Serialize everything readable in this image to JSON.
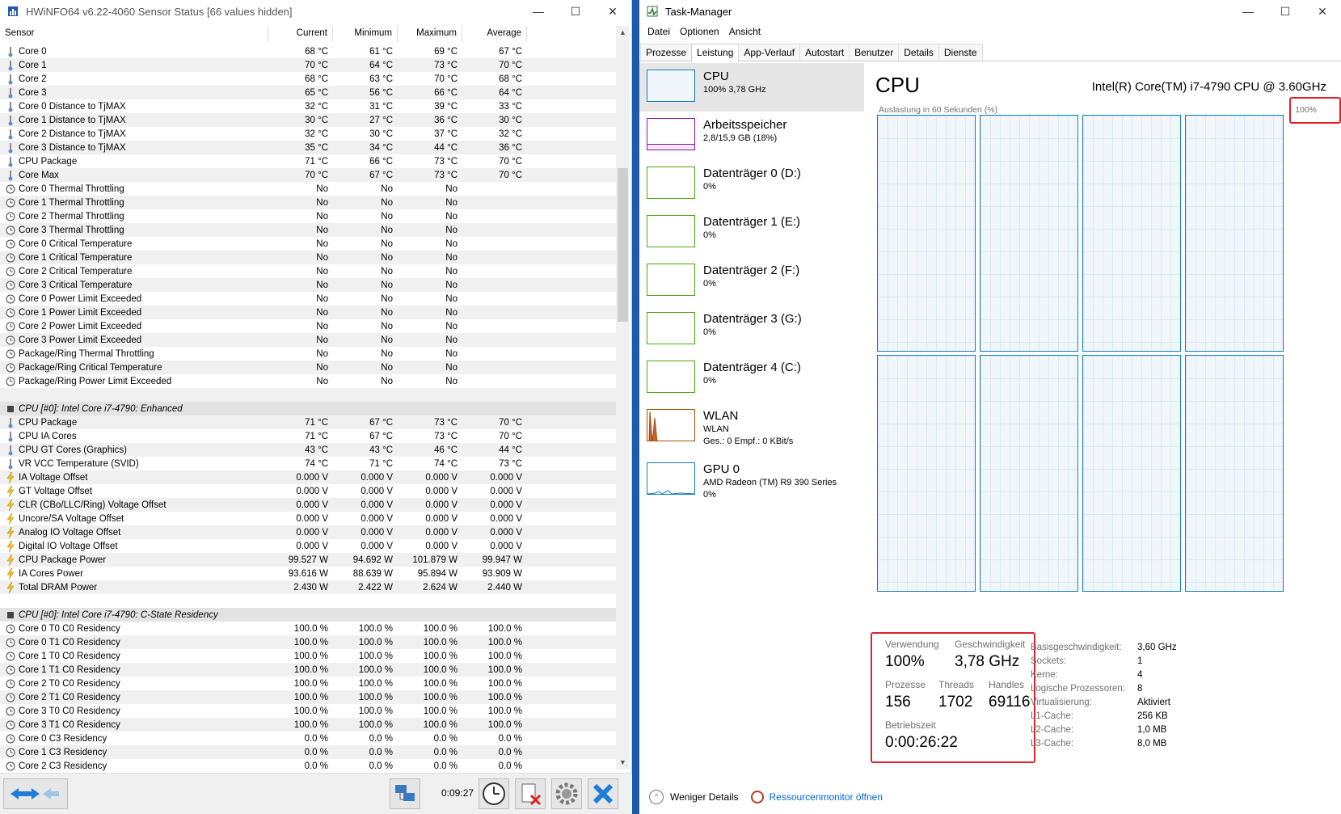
{
  "hwinfo": {
    "title": "HWiNFO64 v6.22-4060 Sensor Status [66 values hidden]",
    "headers": [
      "Sensor",
      "Current",
      "Minimum",
      "Maximum",
      "Average"
    ],
    "rows": [
      {
        "icon": "thermometer",
        "label": "Core 0",
        "v": [
          "68 °C",
          "61 °C",
          "69 °C",
          "67 °C"
        ]
      },
      {
        "icon": "thermometer",
        "label": "Core 1",
        "v": [
          "70 °C",
          "64 °C",
          "73 °C",
          "70 °C"
        ]
      },
      {
        "icon": "thermometer",
        "label": "Core 2",
        "v": [
          "68 °C",
          "63 °C",
          "70 °C",
          "68 °C"
        ]
      },
      {
        "icon": "thermometer",
        "label": "Core 3",
        "v": [
          "65 °C",
          "56 °C",
          "66 °C",
          "64 °C"
        ]
      },
      {
        "icon": "thermometer",
        "label": "Core 0 Distance to TjMAX",
        "v": [
          "32 °C",
          "31 °C",
          "39 °C",
          "33 °C"
        ]
      },
      {
        "icon": "thermometer",
        "label": "Core 1 Distance to TjMAX",
        "v": [
          "30 °C",
          "27 °C",
          "36 °C",
          "30 °C"
        ]
      },
      {
        "icon": "thermometer",
        "label": "Core 2 Distance to TjMAX",
        "v": [
          "32 °C",
          "30 °C",
          "37 °C",
          "32 °C"
        ]
      },
      {
        "icon": "thermometer",
        "label": "Core 3 Distance to TjMAX",
        "v": [
          "35 °C",
          "34 °C",
          "44 °C",
          "36 °C"
        ]
      },
      {
        "icon": "thermometer",
        "label": "CPU Package",
        "v": [
          "71 °C",
          "66 °C",
          "73 °C",
          "70 °C"
        ]
      },
      {
        "icon": "thermometer",
        "label": "Core Max",
        "v": [
          "70 °C",
          "67 °C",
          "73 °C",
          "70 °C"
        ]
      },
      {
        "icon": "clock",
        "label": "Core 0 Thermal Throttling",
        "v": [
          "No",
          "No",
          "No",
          ""
        ]
      },
      {
        "icon": "clock",
        "label": "Core 1 Thermal Throttling",
        "v": [
          "No",
          "No",
          "No",
          ""
        ]
      },
      {
        "icon": "clock",
        "label": "Core 2 Thermal Throttling",
        "v": [
          "No",
          "No",
          "No",
          ""
        ]
      },
      {
        "icon": "clock",
        "label": "Core 3 Thermal Throttling",
        "v": [
          "No",
          "No",
          "No",
          ""
        ]
      },
      {
        "icon": "clock",
        "label": "Core 0 Critical Temperature",
        "v": [
          "No",
          "No",
          "No",
          ""
        ]
      },
      {
        "icon": "clock",
        "label": "Core 1 Critical Temperature",
        "v": [
          "No",
          "No",
          "No",
          ""
        ]
      },
      {
        "icon": "clock",
        "label": "Core 2 Critical Temperature",
        "v": [
          "No",
          "No",
          "No",
          ""
        ]
      },
      {
        "icon": "clock",
        "label": "Core 3 Critical Temperature",
        "v": [
          "No",
          "No",
          "No",
          ""
        ]
      },
      {
        "icon": "clock",
        "label": "Core 0 Power Limit Exceeded",
        "v": [
          "No",
          "No",
          "No",
          ""
        ]
      },
      {
        "icon": "clock",
        "label": "Core 1 Power Limit Exceeded",
        "v": [
          "No",
          "No",
          "No",
          ""
        ]
      },
      {
        "icon": "clock",
        "label": "Core 2 Power Limit Exceeded",
        "v": [
          "No",
          "No",
          "No",
          ""
        ]
      },
      {
        "icon": "clock",
        "label": "Core 3 Power Limit Exceeded",
        "v": [
          "No",
          "No",
          "No",
          ""
        ]
      },
      {
        "icon": "clock",
        "label": "Package/Ring Thermal Throttling",
        "v": [
          "No",
          "No",
          "No",
          ""
        ]
      },
      {
        "icon": "clock",
        "label": "Package/Ring Critical Temperature",
        "v": [
          "No",
          "No",
          "No",
          ""
        ]
      },
      {
        "icon": "clock",
        "label": "Package/Ring Power Limit Exceeded",
        "v": [
          "No",
          "No",
          "No",
          ""
        ]
      },
      {
        "icon": "none",
        "label": "",
        "v": [
          "",
          "",
          "",
          ""
        ]
      },
      {
        "icon": "chip",
        "label": "CPU [#0]: Intel Core i7-4790: Enhanced",
        "v": [
          "",
          "",
          "",
          ""
        ],
        "group": true
      },
      {
        "icon": "thermometer",
        "label": "CPU Package",
        "v": [
          "71 °C",
          "67 °C",
          "73 °C",
          "70 °C"
        ]
      },
      {
        "icon": "thermometer",
        "label": "CPU IA Cores",
        "v": [
          "71 °C",
          "67 °C",
          "73 °C",
          "70 °C"
        ]
      },
      {
        "icon": "thermometer",
        "label": "CPU GT Cores (Graphics)",
        "v": [
          "43 °C",
          "43 °C",
          "46 °C",
          "44 °C"
        ]
      },
      {
        "icon": "thermometer",
        "label": "VR VCC Temperature (SVID)",
        "v": [
          "74 °C",
          "71 °C",
          "74 °C",
          "73 °C"
        ]
      },
      {
        "icon": "bolt",
        "label": "IA Voltage Offset",
        "v": [
          "0.000 V",
          "0.000 V",
          "0.000 V",
          "0.000 V"
        ]
      },
      {
        "icon": "bolt",
        "label": "GT Voltage Offset",
        "v": [
          "0.000 V",
          "0.000 V",
          "0.000 V",
          "0.000 V"
        ]
      },
      {
        "icon": "bolt",
        "label": "CLR (CBo/LLC/Ring) Voltage Offset",
        "v": [
          "0.000 V",
          "0.000 V",
          "0.000 V",
          "0.000 V"
        ]
      },
      {
        "icon": "bolt",
        "label": "Uncore/SA Voltage Offset",
        "v": [
          "0.000 V",
          "0.000 V",
          "0.000 V",
          "0.000 V"
        ]
      },
      {
        "icon": "bolt",
        "label": "Analog IO Voltage Offset",
        "v": [
          "0.000 V",
          "0.000 V",
          "0.000 V",
          "0.000 V"
        ]
      },
      {
        "icon": "bolt",
        "label": "Digital IO Voltage Offset",
        "v": [
          "0.000 V",
          "0.000 V",
          "0.000 V",
          "0.000 V"
        ]
      },
      {
        "icon": "bolt",
        "label": "CPU Package Power",
        "v": [
          "99.527 W",
          "94.692 W",
          "101.879 W",
          "99.947 W"
        ]
      },
      {
        "icon": "bolt",
        "label": "IA Cores Power",
        "v": [
          "93.616 W",
          "88.639 W",
          "95.894 W",
          "93.909 W"
        ]
      },
      {
        "icon": "bolt",
        "label": "Total DRAM Power",
        "v": [
          "2.430 W",
          "2.422 W",
          "2.624 W",
          "2.440 W"
        ]
      },
      {
        "icon": "none",
        "label": "",
        "v": [
          "",
          "",
          "",
          ""
        ]
      },
      {
        "icon": "chip",
        "label": "CPU [#0]: Intel Core i7-4790: C-State Residency",
        "v": [
          "",
          "",
          "",
          ""
        ],
        "group": true
      },
      {
        "icon": "clock",
        "label": "Core 0 T0 C0 Residency",
        "v": [
          "100.0 %",
          "100.0 %",
          "100.0 %",
          "100.0 %"
        ]
      },
      {
        "icon": "clock",
        "label": "Core 0 T1 C0 Residency",
        "v": [
          "100.0 %",
          "100.0 %",
          "100.0 %",
          "100.0 %"
        ]
      },
      {
        "icon": "clock",
        "label": "Core 1 T0 C0 Residency",
        "v": [
          "100.0 %",
          "100.0 %",
          "100.0 %",
          "100.0 %"
        ]
      },
      {
        "icon": "clock",
        "label": "Core 1 T1 C0 Residency",
        "v": [
          "100.0 %",
          "100.0 %",
          "100.0 %",
          "100.0 %"
        ]
      },
      {
        "icon": "clock",
        "label": "Core 2 T0 C0 Residency",
        "v": [
          "100.0 %",
          "100.0 %",
          "100.0 %",
          "100.0 %"
        ]
      },
      {
        "icon": "clock",
        "label": "Core 2 T1 C0 Residency",
        "v": [
          "100.0 %",
          "100.0 %",
          "100.0 %",
          "100.0 %"
        ]
      },
      {
        "icon": "clock",
        "label": "Core 3 T0 C0 Residency",
        "v": [
          "100.0 %",
          "100.0 %",
          "100.0 %",
          "100.0 %"
        ]
      },
      {
        "icon": "clock",
        "label": "Core 3 T1 C0 Residency",
        "v": [
          "100.0 %",
          "100.0 %",
          "100.0 %",
          "100.0 %"
        ]
      },
      {
        "icon": "clock",
        "label": "Core 0 C3 Residency",
        "v": [
          "0.0 %",
          "0.0 %",
          "0.0 %",
          "0.0 %"
        ]
      },
      {
        "icon": "clock",
        "label": "Core 1 C3 Residency",
        "v": [
          "0.0 %",
          "0.0 %",
          "0.0 %",
          "0.0 %"
        ]
      },
      {
        "icon": "clock",
        "label": "Core 2 C3 Residency",
        "v": [
          "0.0 %",
          "0.0 %",
          "0.0 %",
          "0.0 %"
        ]
      }
    ],
    "elapsed": "0:09:27"
  },
  "taskmgr": {
    "title": "Task-Manager",
    "menu": [
      "Datei",
      "Optionen",
      "Ansicht"
    ],
    "tabs": [
      "Prozesse",
      "Leistung",
      "App-Verlauf",
      "Autostart",
      "Benutzer",
      "Details",
      "Dienste"
    ],
    "active_tab": "Leistung",
    "items": [
      {
        "title": "CPU",
        "sub": "100% 3,78 GHz",
        "sub2": "",
        "sub3": "",
        "color": "#117dbb"
      },
      {
        "title": "Arbeitsspeicher",
        "sub": "2,8/15,9 GB (18%)",
        "sub2": "",
        "sub3": "",
        "color": "#8b12ae"
      },
      {
        "title": "Datenträger 0 (D:)",
        "sub": "0%",
        "sub2": "",
        "sub3": "",
        "color": "#4da60c"
      },
      {
        "title": "Datenträger 1 (E:)",
        "sub": "0%",
        "sub2": "",
        "sub3": "",
        "color": "#4da60c"
      },
      {
        "title": "Datenträger 2 (F:)",
        "sub": "0%",
        "sub2": "",
        "sub3": "",
        "color": "#4da60c"
      },
      {
        "title": "Datenträger 3 (G:)",
        "sub": "0%",
        "sub2": "",
        "sub3": "",
        "color": "#4da60c"
      },
      {
        "title": "Datenträger 4 (C:)",
        "sub": "0%",
        "sub2": "",
        "sub3": "",
        "color": "#4da60c"
      },
      {
        "title": "WLAN",
        "sub": "WLAN",
        "sub2": "Ges.: 0 Empf.: 0 KBit/s",
        "sub3": "",
        "color": "#a74f01"
      },
      {
        "title": "GPU 0",
        "sub": "AMD Radeon (TM) R9 390 Series",
        "sub2": "0%",
        "sub3": "",
        "color": "#117dbb"
      }
    ],
    "cpu": {
      "heading": "CPU",
      "model": "Intel(R) Core(TM) i7-4790 CPU @ 3.60GHz",
      "util_label": "Auslastung in 60 Sekunden (%)",
      "util_max": "100%",
      "utilization_percent": 100,
      "stats": {
        "usage_lbl": "Verwendung",
        "usage": "100%",
        "speed_lbl": "Geschwindigkeit",
        "speed": "3,78 GHz",
        "proc_lbl": "Prozesse",
        "proc": "156",
        "threads_lbl": "Threads",
        "threads": "1702",
        "handles_lbl": "Handles",
        "handles": "69116",
        "uptime_lbl": "Betriebszeit",
        "uptime": "0:00:26:22"
      },
      "specs": [
        {
          "k": "Basisgeschwindigkeit:",
          "v": "3,60 GHz"
        },
        {
          "k": "Sockets:",
          "v": "1"
        },
        {
          "k": "Kerne:",
          "v": "4"
        },
        {
          "k": "Logische Prozessoren:",
          "v": "8"
        },
        {
          "k": "Virtualisierung:",
          "v": "Aktiviert"
        },
        {
          "k": "L1-Cache:",
          "v": "256 KB"
        },
        {
          "k": "L2-Cache:",
          "v": "1,0 MB"
        },
        {
          "k": "L3-Cache:",
          "v": "8,0 MB"
        }
      ]
    },
    "footer": {
      "less": "Weniger Details",
      "resmon": "Ressourcenmonitor öffnen"
    }
  }
}
